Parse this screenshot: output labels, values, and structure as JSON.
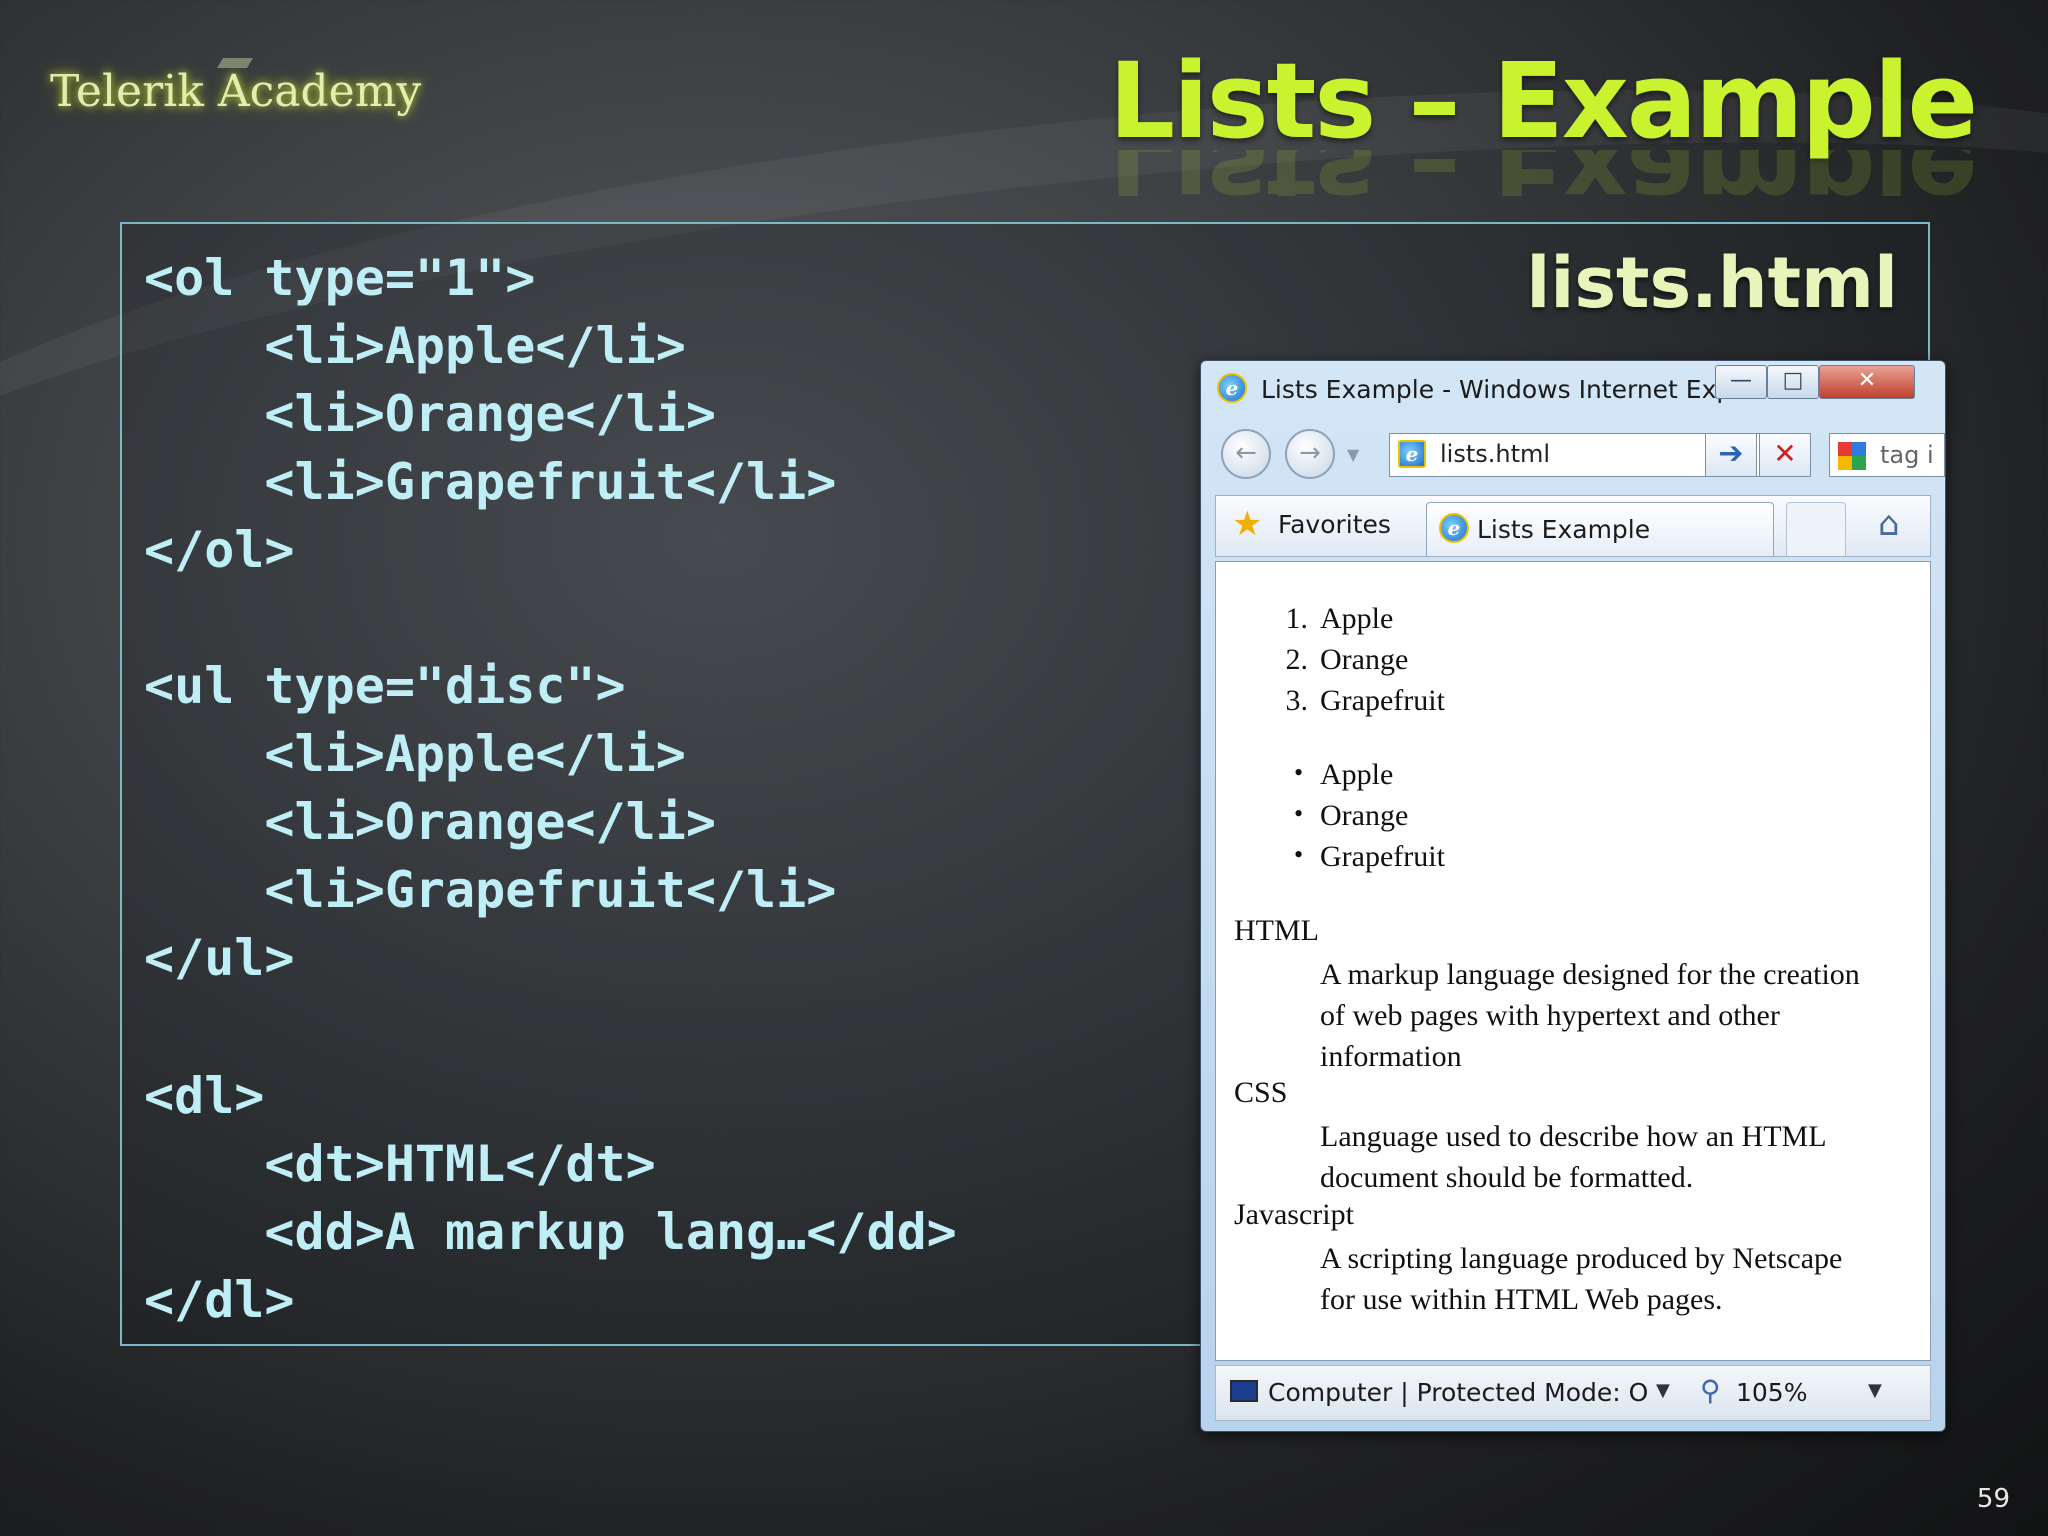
{
  "header": {
    "logo_text": "Telerik Academy",
    "title": "Lists – Example"
  },
  "code_panel": {
    "filename": "lists.html",
    "lines": [
      "<ol type=\"1\">",
      "    <li>Apple</li>",
      "    <li>Orange</li>",
      "    <li>Grapefruit</li>",
      "</ol>",
      "<ul type=\"disc\">",
      "    <li>Apple</li>",
      "    <li>Orange</li>",
      "    <li>Grapefruit</li>",
      "</ul>",
      "<dl>",
      "    <dt>HTML</dt>",
      "    <dd>A markup lang…</dd>",
      "</dl>"
    ]
  },
  "browser": {
    "window_title": "Lists Example - Windows Internet Exp...",
    "address": "lists.html",
    "search_text": "tag i",
    "favorites_label": "Favorites",
    "tab_label": "Lists Example",
    "ordered_list": [
      {
        "marker": "1.",
        "text": "Apple"
      },
      {
        "marker": "2.",
        "text": "Orange"
      },
      {
        "marker": "3.",
        "text": "Grapefruit"
      }
    ],
    "unordered_list": [
      "Apple",
      "Orange",
      "Grapefruit"
    ],
    "definitions": [
      {
        "term": "HTML",
        "lines": [
          "A markup language designed for the creation",
          "of web pages with hypertext and other",
          "information"
        ]
      },
      {
        "term": "CSS",
        "lines": [
          "Language used to describe how an HTML",
          "document should be formatted."
        ]
      },
      {
        "term": "Javascript",
        "lines": [
          "A scripting language produced by Netscape",
          "for use within HTML Web pages."
        ]
      }
    ],
    "status_text": "Computer | Protected Mode: O",
    "zoom": "105%"
  },
  "page_number": "59"
}
